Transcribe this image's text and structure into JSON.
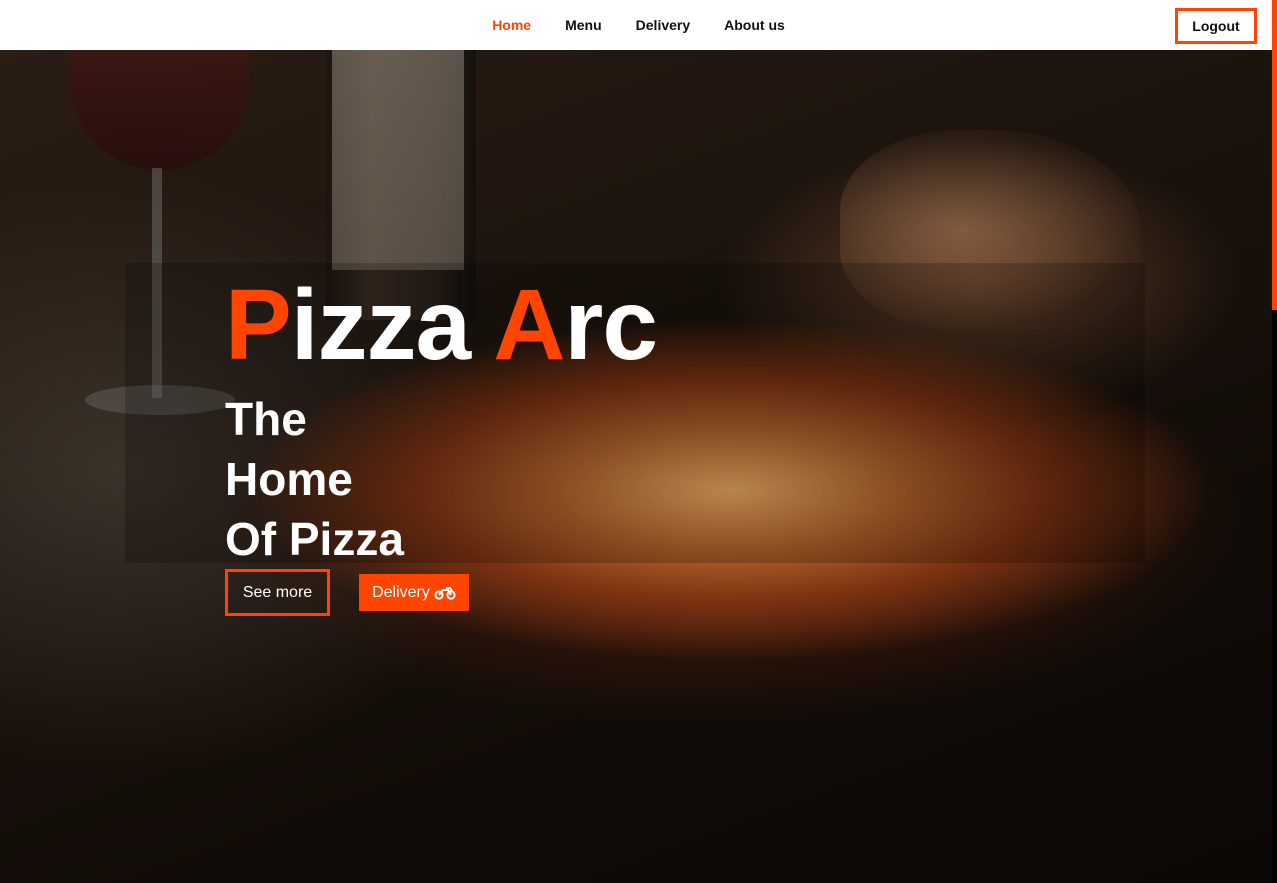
{
  "colors": {
    "accent": "#ff4500"
  },
  "nav": {
    "items": [
      {
        "label": "Home",
        "active": true
      },
      {
        "label": "Menu",
        "active": false
      },
      {
        "label": "Delivery",
        "active": false
      },
      {
        "label": "About us",
        "active": false
      }
    ],
    "logout_label": "Logout"
  },
  "hero": {
    "title_word1_first": "P",
    "title_word1_rest": "izza",
    "title_word2_first": "A",
    "title_word2_rest": "rc",
    "tagline_lines": [
      "The",
      "Home",
      "Of Pizza"
    ],
    "see_more_label": "See more",
    "delivery_label": "Delivery",
    "delivery_icon": "motorcycle-icon",
    "background_image": "pizza-restaurant-photo"
  }
}
